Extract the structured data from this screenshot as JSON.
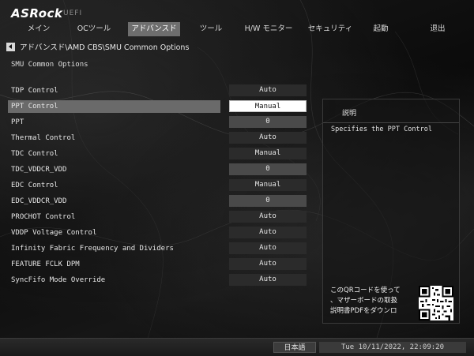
{
  "brand": {
    "logo": "ASRock",
    "subtitle": "UEFI"
  },
  "nav": {
    "tabs": [
      {
        "label": "メイン",
        "active": false
      },
      {
        "label": "OCツール",
        "active": false
      },
      {
        "label": "アドバンスド",
        "active": true
      },
      {
        "label": "ツール",
        "active": false
      },
      {
        "label": "H/W モニター",
        "active": false
      },
      {
        "label": "セキュリティ",
        "active": false
      },
      {
        "label": "起動",
        "active": false
      },
      {
        "label": "退出",
        "active": false
      }
    ]
  },
  "breadcrumb": {
    "path": "アドバンスド\\AMD CBS\\SMU Common Options"
  },
  "section": {
    "title": "SMU Common Options"
  },
  "settings": [
    {
      "label": "TDP Control",
      "value": "Auto"
    },
    {
      "label": "PPT Control",
      "value": "Manual"
    },
    {
      "label": "PPT",
      "value": "0"
    },
    {
      "label": "Thermal Control",
      "value": "Auto"
    },
    {
      "label": "TDC Control",
      "value": "Manual"
    },
    {
      "label": "TDC_VDDCR_VDD",
      "value": "0"
    },
    {
      "label": "EDC Control",
      "value": "Manual"
    },
    {
      "label": "EDC_VDDCR_VDD",
      "value": "0"
    },
    {
      "label": "PROCHOT Control",
      "value": "Auto"
    },
    {
      "label": "VDDP Voltage Control",
      "value": "Auto"
    },
    {
      "label": "Infinity Fabric Frequency and Dividers",
      "value": "Auto"
    },
    {
      "label": "FEATURE FCLK DPM",
      "value": "Auto"
    },
    {
      "label": "SyncFifo Mode Override",
      "value": "Auto"
    }
  ],
  "help": {
    "title": "説明",
    "text": "Specifies the PPT Control"
  },
  "qr": {
    "line1": "このQRコードを使って",
    "line2": "、マザーボードの取扱",
    "line3": "説明書PDFをダウンロ"
  },
  "footer": {
    "language": "日本語",
    "datetime": "Tue 10/11/2022, 22:09:20"
  }
}
